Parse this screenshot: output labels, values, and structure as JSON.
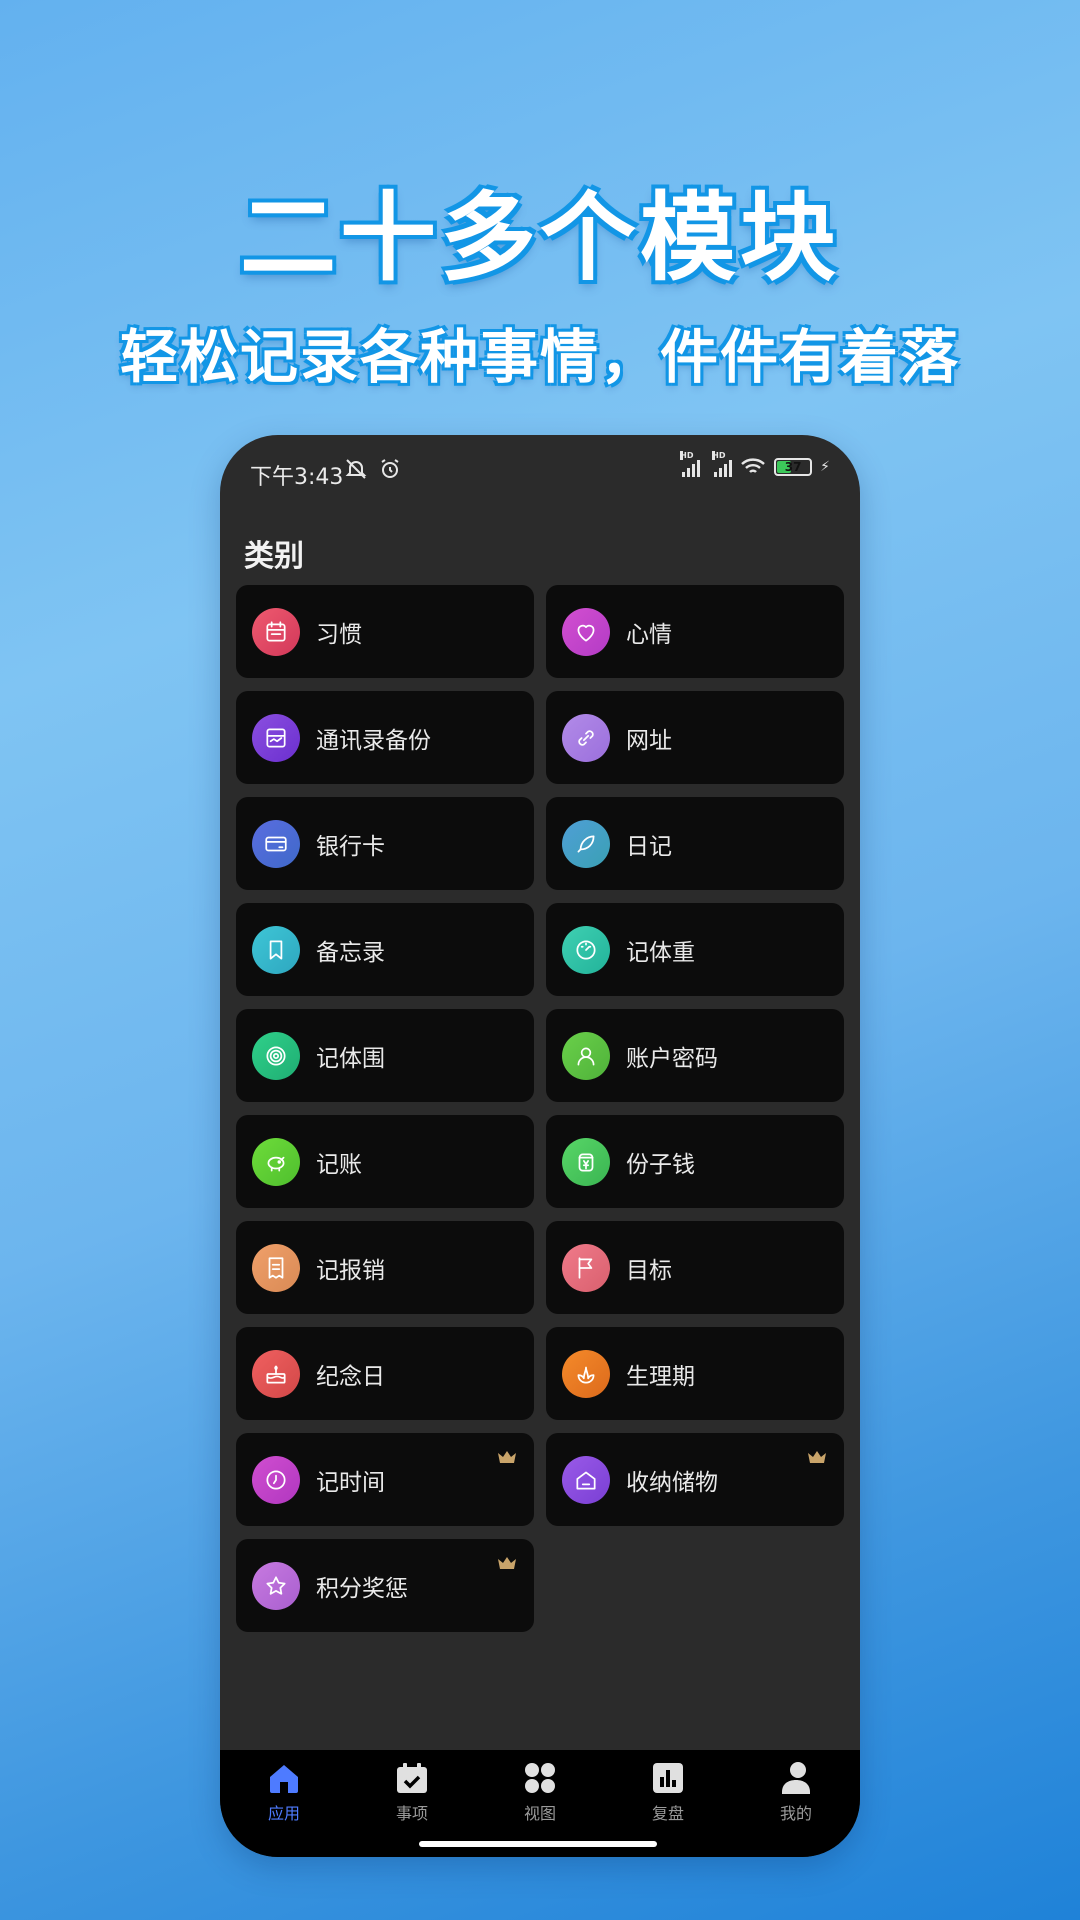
{
  "promo": {
    "headline": "二十多个模块",
    "subline": "轻松记录各种事情，件件有着落"
  },
  "status_bar": {
    "time": "下午3:43",
    "battery": "37"
  },
  "page_title": "类别",
  "categories": [
    {
      "label": "习惯",
      "icon": "calendar-icon",
      "color_from": "#ef5a6f",
      "color_to": "#d2385a",
      "premium": false
    },
    {
      "label": "心情",
      "icon": "heart-icon",
      "color_from": "#d34fd0",
      "color_to": "#b33bc6",
      "premium": false
    },
    {
      "label": "通讯录备份",
      "icon": "contacts-icon",
      "color_from": "#8b4fe0",
      "color_to": "#6b2fcf",
      "premium": false
    },
    {
      "label": "网址",
      "icon": "link-icon",
      "color_from": "#b28be8",
      "color_to": "#9b6fdc",
      "premium": false
    },
    {
      "label": "银行卡",
      "icon": "card-icon",
      "color_from": "#5a6de0",
      "color_to": "#3f69c9",
      "premium": false
    },
    {
      "label": "日记",
      "icon": "feather-icon",
      "color_from": "#4f9fd6",
      "color_to": "#3aa0b4",
      "premium": false
    },
    {
      "label": "备忘录",
      "icon": "bookmark-icon",
      "color_from": "#3ec6d6",
      "color_to": "#2ea7c0",
      "premium": false
    },
    {
      "label": "记体重",
      "icon": "scale-icon",
      "color_from": "#3fd0b2",
      "color_to": "#22b39a",
      "premium": false
    },
    {
      "label": "记体围",
      "icon": "target-icon",
      "color_from": "#2fd08a",
      "color_to": "#1fae73",
      "premium": false
    },
    {
      "label": "账户密码",
      "icon": "user-icon",
      "color_from": "#6ad04a",
      "color_to": "#4fb23a",
      "premium": false
    },
    {
      "label": "记账",
      "icon": "piggy-bank-icon",
      "color_from": "#6edc3a",
      "color_to": "#4fbf2e",
      "premium": false
    },
    {
      "label": "份子钱",
      "icon": "money-jar-icon",
      "color_from": "#58d667",
      "color_to": "#3ab552",
      "premium": false
    },
    {
      "label": "记报销",
      "icon": "receipt-icon",
      "color_from": "#f0a06a",
      "color_to": "#d98a55",
      "premium": false
    },
    {
      "label": "目标",
      "icon": "flag-icon",
      "color_from": "#f07a8a",
      "color_to": "#d9606e",
      "premium": false
    },
    {
      "label": "纪念日",
      "icon": "cake-icon",
      "color_from": "#f06060",
      "color_to": "#d24848",
      "premium": false
    },
    {
      "label": "生理期",
      "icon": "flower-icon",
      "color_from": "#f58a2a",
      "color_to": "#dc6a1c",
      "premium": false
    },
    {
      "label": "记时间",
      "icon": "clock-icon",
      "color_from": "#d04ed0",
      "color_to": "#b137c0",
      "premium": true
    },
    {
      "label": "收纳储物",
      "icon": "house-icon",
      "color_from": "#9a5ae8",
      "color_to": "#7a3fd4",
      "premium": true
    },
    {
      "label": "积分奖惩",
      "icon": "star-icon",
      "color_from": "#c77ae0",
      "color_to": "#a95fcf",
      "premium": true
    }
  ],
  "tabs": [
    {
      "label": "应用",
      "icon": "home-icon",
      "active": true
    },
    {
      "label": "事项",
      "icon": "calendar-check-icon",
      "active": false
    },
    {
      "label": "视图",
      "icon": "grid-icon",
      "active": false
    },
    {
      "label": "复盘",
      "icon": "chart-icon",
      "active": false
    },
    {
      "label": "我的",
      "icon": "person-icon",
      "active": false
    }
  ],
  "colors": {
    "active_tab": "#4e7bff",
    "crown": "#c9a46a",
    "card_bg": "#0c0c0c",
    "screen_bg": "#2b2b2b"
  }
}
